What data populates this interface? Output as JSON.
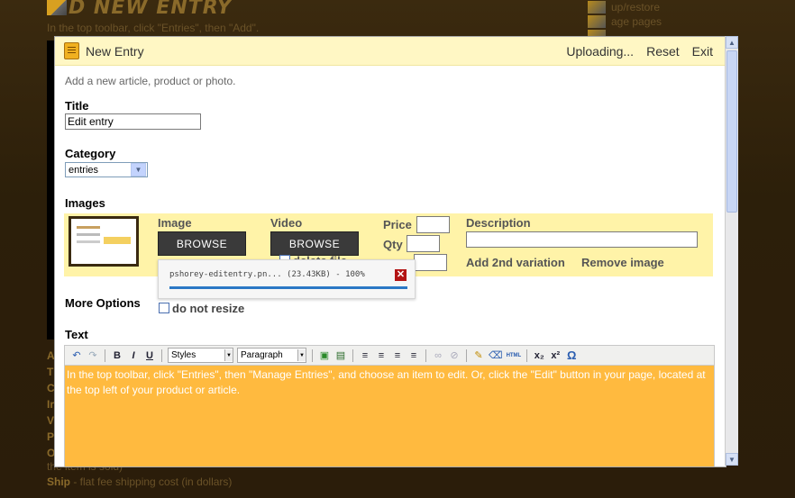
{
  "background": {
    "heading": "D NEW ENTRY",
    "instruction": "In the top toolbar, click \"Entries\", then \"Add\".",
    "side_links": [
      "up/restore",
      "age pages",
      ""
    ],
    "letters": [
      "A",
      "T",
      "C",
      "Ir",
      "V",
      "P",
      "O"
    ],
    "bottom_line1": "the item is sold)",
    "bottom_ship_label": "Ship",
    "bottom_ship_text": " - flat fee shipping cost (in dollars)"
  },
  "modal": {
    "title": "New Entry",
    "actions": {
      "uploading": "Uploading...",
      "reset": "Reset",
      "exit": "Exit"
    },
    "intro": "Add a new article, product or photo.",
    "title_label": "Title",
    "title_value": "Edit entry",
    "category_label": "Category",
    "category_value": "entries",
    "images_label": "Images",
    "images_row": {
      "image_label": "Image",
      "video_label": "Video",
      "browse_image": "BROWSE",
      "browse_video": "BROWSE",
      "price_label": "Price",
      "qty_label": "Qty",
      "description_label": "Description",
      "delete_file": "delete file",
      "add_variation": "Add 2nd variation",
      "remove_image": "Remove image"
    },
    "upload": {
      "text": "pshorey-editentry.pn... (23.43KB) - 100%",
      "progress": 1.0
    },
    "more_options_label": "More Options",
    "do_not_resize": "do not resize",
    "text_label": "Text",
    "toolbar": {
      "styles": "Styles",
      "format": "Paragraph",
      "bold": "B",
      "italic": "I",
      "underline": "U",
      "subscript": "x₂",
      "superscript": "x²",
      "omega": "Ω",
      "html": "HTML"
    },
    "editor_text": "In the top toolbar, click \"Entries\", then \"Manage Entries\", and choose an item to edit. Or, click the \"Edit\" button in your page, located at the top left of your product or article."
  },
  "colors": {
    "header_bg": "#fff7c4",
    "images_row_bg": "#fff3a8",
    "editor_bg": "#ffba3f",
    "close_red": "#b31414",
    "progress_blue": "#2b78c5"
  }
}
